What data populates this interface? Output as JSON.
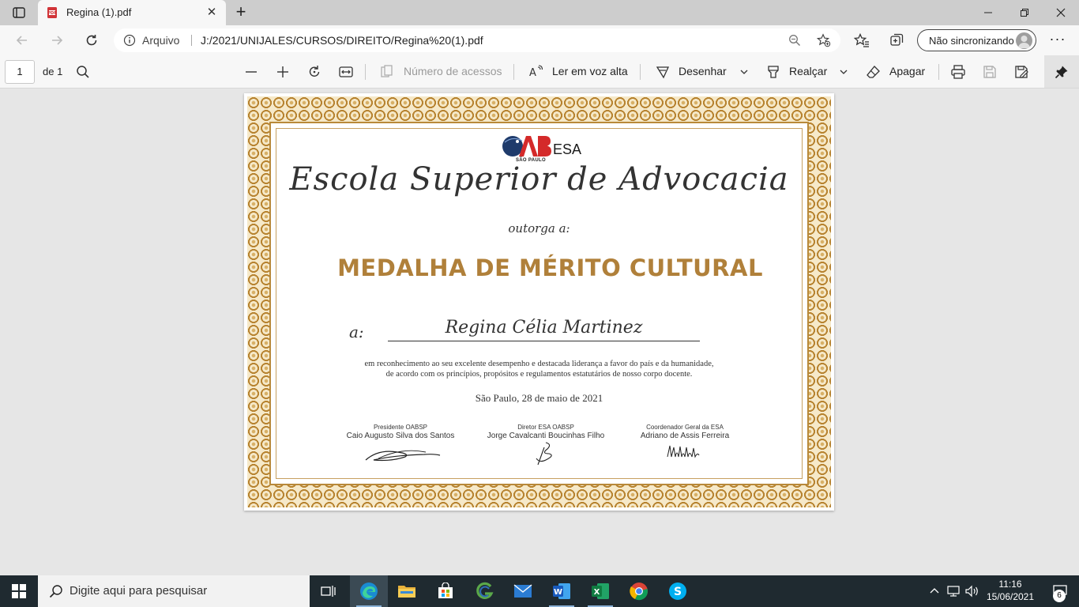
{
  "browser": {
    "tab": {
      "title": "Regina (1).pdf",
      "favicon": "pdf-icon"
    },
    "address": {
      "site_label": "Arquivo",
      "url": "J:/2021/UNIJALES/CURSOS/DIREITO/Regina%20(1).pdf"
    },
    "profile": {
      "label": "Não sincronizando"
    }
  },
  "pdf_toolbar": {
    "page_current": "1",
    "page_total": "de 1",
    "accessibility": "Número de acessos",
    "read_aloud": "Ler em voz alta",
    "draw": "Desenhar",
    "highlight": "Realçar",
    "erase": "Apagar"
  },
  "certificate": {
    "logo_mark": "OAB",
    "logo_suffix": "ESA",
    "logo_sub": "SÃO PAULO",
    "title": "Escola Superior de Advocacia",
    "grant": "outorga a:",
    "medal": "MEDALHA DE MÉRITO CULTURAL",
    "to_label": "a:",
    "recipient": "Regina Célia Martinez",
    "body_line1": "em reconhecimento ao seu excelente desempenho e destacada liderança a favor do país e da humanidade,",
    "body_line2": "de acordo com os princípios, propósitos e regulamentos estatutários de nosso corpo docente.",
    "date": "São Paulo, 28 de maio de 2021",
    "signatories": [
      {
        "role": "Presidente OABSP",
        "name": "Caio Augusto Silva dos Santos"
      },
      {
        "role": "Diretor ESA OABSP",
        "name": "Jorge Cavalcanti Boucinhas Filho"
      },
      {
        "role": "Coordenador Geral da ESA",
        "name": "Adriano de Assis Ferreira"
      }
    ]
  },
  "taskbar": {
    "search_placeholder": "Digite aqui para pesquisar",
    "clock_time": "11:16",
    "clock_date": "15/06/2021",
    "notification_count": "6",
    "apps": [
      "task-view",
      "edge",
      "file-explorer",
      "microsoft-store",
      "g-app",
      "mail",
      "word",
      "excel",
      "chrome",
      "skype"
    ]
  },
  "colors": {
    "gold": "#b0803a",
    "frame": "#c79a45",
    "taskbar": "#1f2a30"
  }
}
